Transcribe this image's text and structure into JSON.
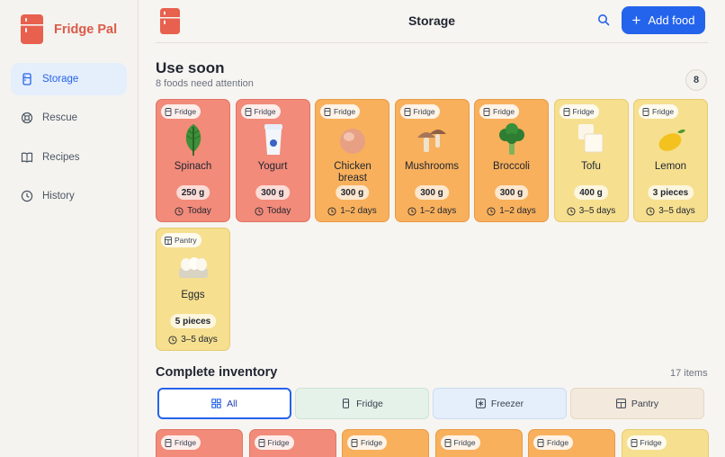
{
  "app": {
    "name": "Fridge Pal"
  },
  "sidebar": {
    "items": [
      {
        "label": "Storage",
        "icon": "fridge-icon",
        "active": true
      },
      {
        "label": "Rescue",
        "icon": "lifebuoy-icon",
        "active": false
      },
      {
        "label": "Recipes",
        "icon": "book-icon",
        "active": false
      },
      {
        "label": "History",
        "icon": "clock-icon",
        "active": false
      }
    ]
  },
  "header": {
    "title": "Storage",
    "search_icon": "search-icon",
    "add_label": "Add food"
  },
  "use_soon": {
    "title": "Use soon",
    "subtitle": "8 foods need attention",
    "count": "8",
    "items": [
      {
        "name": "Spinach",
        "location": "Fridge",
        "qty": "250 g",
        "time": "Today",
        "urgency": "red",
        "icon": "spinach-icon"
      },
      {
        "name": "Yogurt",
        "location": "Fridge",
        "qty": "300 g",
        "time": "Today",
        "urgency": "red",
        "icon": "yogurt-icon"
      },
      {
        "name": "Chicken breast",
        "location": "Fridge",
        "qty": "300 g",
        "time": "1–2 days",
        "urgency": "orange",
        "icon": "chicken-icon"
      },
      {
        "name": "Mushrooms",
        "location": "Fridge",
        "qty": "300 g",
        "time": "1–2 days",
        "urgency": "orange",
        "icon": "mushroom-icon"
      },
      {
        "name": "Broccoli",
        "location": "Fridge",
        "qty": "300 g",
        "time": "1–2 days",
        "urgency": "orange",
        "icon": "broccoli-icon"
      },
      {
        "name": "Tofu",
        "location": "Fridge",
        "qty": "400 g",
        "time": "3–5 days",
        "urgency": "yellow",
        "icon": "tofu-icon"
      },
      {
        "name": "Lemon",
        "location": "Fridge",
        "qty": "3 pieces",
        "time": "3–5 days",
        "urgency": "yellow",
        "icon": "lemon-icon"
      },
      {
        "name": "Eggs",
        "location": "Pantry",
        "qty": "5 pieces",
        "time": "3–5 days",
        "urgency": "yellow",
        "icon": "eggs-icon"
      }
    ]
  },
  "inventory": {
    "title": "Complete inventory",
    "count": "17 items",
    "filters": [
      {
        "label": "All",
        "icon": "grid-icon",
        "selected": true
      },
      {
        "label": "Fridge",
        "icon": "fridge-icon",
        "selected": false
      },
      {
        "label": "Freezer",
        "icon": "snowflake-icon",
        "selected": false
      },
      {
        "label": "Pantry",
        "icon": "cabinet-icon",
        "selected": false
      }
    ],
    "cards": [
      {
        "location": "Fridge",
        "urgency": "red"
      },
      {
        "location": "Fridge",
        "urgency": "red"
      },
      {
        "location": "Fridge",
        "urgency": "orange"
      },
      {
        "location": "Fridge",
        "urgency": "orange"
      },
      {
        "location": "Fridge",
        "urgency": "orange"
      },
      {
        "location": "Fridge",
        "urgency": "yellow"
      }
    ]
  },
  "colors": {
    "brand": "#dc5a4a",
    "accent": "#2463eb",
    "urgent_red": "#f28b7a",
    "soon_orange": "#f8b05c",
    "later_yellow": "#f6df8f"
  }
}
